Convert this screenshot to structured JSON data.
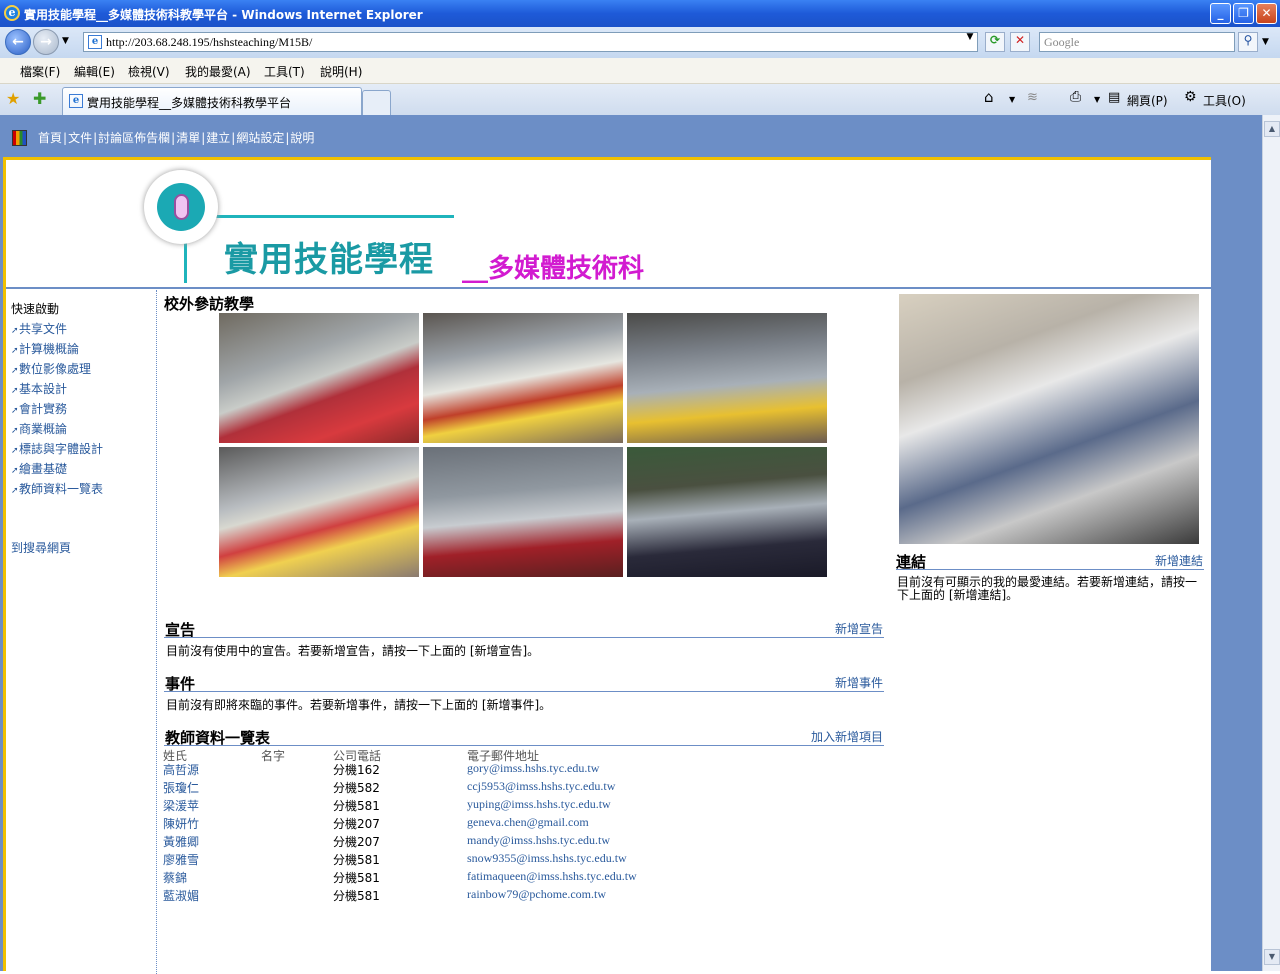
{
  "window": {
    "title": "實用技能學程__多媒體技術科教學平台 - Windows Internet Explorer",
    "minimize": "_",
    "restore": "❐",
    "close": "✕"
  },
  "address": {
    "url": "http://203.68.248.195/hshsteaching/M15B/",
    "search_placeholder": "Google",
    "back": "←",
    "forward": "→",
    "refresh": "⟳",
    "stop": "✕",
    "search_go": "⚲"
  },
  "menu": [
    "檔案(F)",
    "編輯(E)",
    "檢視(V)",
    "我的最愛(A)",
    "工具(T)",
    "說明(H)"
  ],
  "tabs": {
    "active": "實用技能學程__多媒體技術科教學平台",
    "page_menu": "網頁(P)",
    "tools_menu": "工具(O)"
  },
  "topnav": [
    "首頁",
    "文件",
    "討論區佈告欄",
    "清單",
    "建立",
    "網站設定",
    "說明"
  ],
  "banner": {
    "title": "實用技能學程",
    "subtitle": "__多媒體技術科"
  },
  "quicklaunch": {
    "title": "快速啟動",
    "items": [
      "共享文件",
      "計算機概論",
      "數位影像處理",
      "基本設計",
      "會計實務",
      "商業概論",
      "標誌與字體設計",
      "繪畫基礎",
      "教師資料一覽表"
    ],
    "search_link": "到搜尋網頁"
  },
  "gallery": {
    "title": "校外參訪教學",
    "photo_count": 6
  },
  "announcements": {
    "title": "宣告",
    "add_link": "新增宣告",
    "empty_text": "目前沒有使用中的宣告。若要新增宣告，請按一下上面的 [新增宣告]。"
  },
  "events": {
    "title": "事件",
    "add_link": "新增事件",
    "empty_text": "目前沒有即將來臨的事件。若要新增事件，請按一下上面的 [新增事件]。"
  },
  "links": {
    "title": "連結",
    "add_link": "新增連結",
    "empty_text_line1": "目前沒有可顯示的我的最愛連結。若要新增連結，請按一",
    "empty_text_line2": "下上面的 [新增連結]。"
  },
  "teachers": {
    "title": "教師資料一覽表",
    "add_link": "加入新增項目",
    "columns": [
      "姓氏",
      "名字",
      "公司電話",
      "電子郵件地址"
    ],
    "rows": [
      {
        "last": "高哲源",
        "first": "",
        "phone": "分機162",
        "email": "gory@imss.hshs.tyc.edu.tw"
      },
      {
        "last": "張瓊仁",
        "first": "",
        "phone": "分機582",
        "email": "ccj5953@imss.hshs.tyc.edu.tw"
      },
      {
        "last": "梁湲苹",
        "first": "",
        "phone": "分機581",
        "email": "yuping@imss.hshs.tyc.edu.tw"
      },
      {
        "last": "陳妍竹",
        "first": "",
        "phone": "分機207",
        "email": "geneva.chen@gmail.com"
      },
      {
        "last": "黃雅卿",
        "first": "",
        "phone": "分機207",
        "email": "mandy@imss.hshs.tyc.edu.tw"
      },
      {
        "last": "廖雅雪",
        "first": "",
        "phone": "分機581",
        "email": "snow9355@imss.hshs.tyc.edu.tw"
      },
      {
        "last": "蔡錦",
        "first": "",
        "phone": "分機581",
        "email": "fatimaqueen@imss.hshs.tyc.edu.tw"
      },
      {
        "last": "藍淑媚",
        "first": "",
        "phone": "分機581",
        "email": "rainbow79@pchome.com.tw"
      }
    ]
  },
  "colors": {
    "accent_blue": "#6c8ec6",
    "banner_teal": "#1a9aa4",
    "banner_magenta": "#d21bd0",
    "border_gold": "#f0c000",
    "link": "#2a5a9c"
  }
}
